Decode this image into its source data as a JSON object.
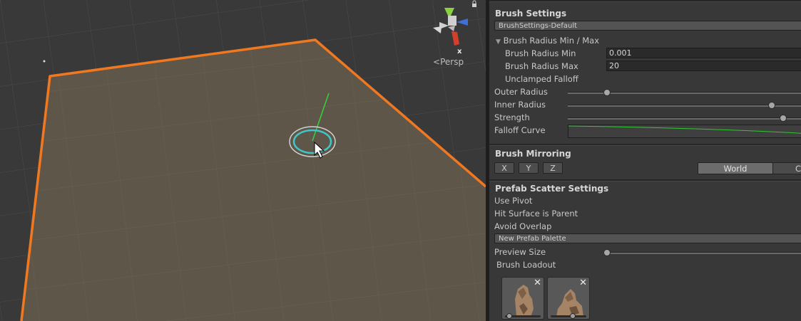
{
  "scene": {
    "view_label": "Persp",
    "gizmo_axis_label": "x",
    "colors": {
      "outline": "#f07820",
      "plane": "#5e5648",
      "brush_ring": "#3fc6c9",
      "normal_line": "#36d23a"
    }
  },
  "inspector": {
    "brush_settings": {
      "title": "Brush Settings",
      "preset": "BrushSettings-Default",
      "radius_group_label": "Brush Radius Min / Max",
      "radius_min_label": "Brush Radius Min",
      "radius_min_value": "0.001",
      "radius_max_label": "Brush Radius Max",
      "radius_max_value": "20",
      "unclamped_falloff_label": "Unclamped Falloff",
      "outer_radius_label": "Outer Radius",
      "outer_radius_fraction": 0.15,
      "inner_radius_label": "Inner Radius",
      "inner_radius_fraction": 0.85,
      "strength_label": "Strength",
      "strength_fraction": 0.9,
      "falloff_curve_label": "Falloff Curve"
    },
    "brush_mirroring": {
      "title": "Brush Mirroring",
      "axes": [
        "X",
        "Y",
        "Z"
      ],
      "space_selected": "World",
      "space_other": "C"
    },
    "prefab_scatter": {
      "title": "Prefab Scatter Settings",
      "use_pivot_label": "Use Pivot",
      "hit_surface_label": "Hit Surface is Parent",
      "avoid_overlap_label": "Avoid Overlap",
      "palette": "New Prefab Palette",
      "preview_size_label": "Preview Size",
      "preview_size_fraction": 0.0,
      "brush_loadout_label": "Brush Loadout",
      "loadout_remove_glyph": "✕",
      "loadout": [
        {
          "slider_fraction": 0.05
        },
        {
          "slider_fraction": 0.65
        }
      ]
    }
  }
}
